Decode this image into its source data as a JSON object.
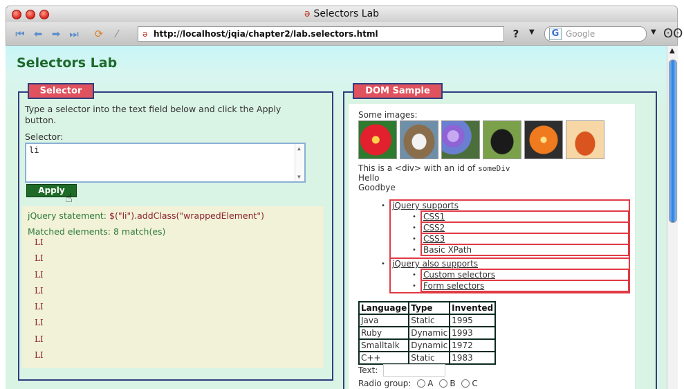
{
  "window": {
    "title": "Selectors Lab"
  },
  "toolbar": {
    "url": "http://localhost/jqia/chapter2/lab.selectors.html",
    "help_label": "?",
    "search_placeholder": "Google"
  },
  "page": {
    "heading": "Selectors Lab",
    "selector_panel": {
      "legend": "Selector",
      "instructions": "Type a selector into the text field below and click the Apply button.",
      "selector_label": "Selector:",
      "selector_value": "li",
      "apply_label": "Apply",
      "statement_label": "jQuery statement:",
      "statement_code": "$(\"li\").addClass(\"wrappedElement\")",
      "matched_text": "Matched elements: 8 match(es)",
      "matches": [
        "LI",
        "LI",
        "LI",
        "LI",
        "LI",
        "LI",
        "LI",
        "LI"
      ]
    },
    "dom_panel": {
      "legend": "DOM Sample",
      "images_label": "Some images:",
      "images": [
        "flower-red",
        "dog",
        "flower-purple",
        "dog-black",
        "flower-orange",
        "teapot"
      ],
      "div_text_prefix": "This is a <div> with an id of",
      "div_id": "someDiv",
      "hello": "Hello",
      "goodbye": "Goodbye",
      "lists": [
        {
          "label": "jQuery supports",
          "items": [
            "CSS1",
            "CSS2",
            "CSS3",
            "Basic XPath"
          ]
        },
        {
          "label": "jQuery also supports",
          "items": [
            "Custom selectors",
            "Form selectors"
          ]
        }
      ],
      "table": {
        "headers": [
          "Language",
          "Type",
          "Invented"
        ],
        "rows": [
          [
            "Java",
            "Static",
            "1995"
          ],
          [
            "Ruby",
            "Dynamic",
            "1993"
          ],
          [
            "Smalltalk",
            "Dynamic",
            "1972"
          ],
          [
            "C++",
            "Static",
            "1983"
          ]
        ]
      },
      "text_label": "Text:",
      "radio_label": "Radio group:",
      "radios": [
        "A",
        "B",
        "C"
      ]
    }
  },
  "colors": {
    "heading": "#1c6a2b",
    "legend_bg": "#e0525d",
    "panel_border": "#2f3f7f",
    "match_border": "#e03a45",
    "apply_bg": "#1e6b28"
  }
}
